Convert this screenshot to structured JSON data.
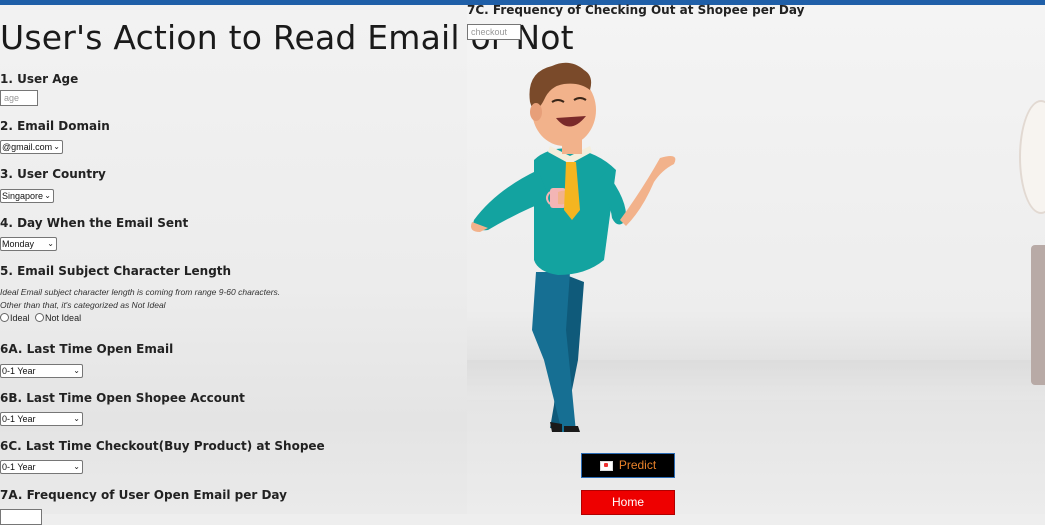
{
  "page": {
    "title": "User's Action to Read Email or Not",
    "accent_color": "#1f5fa8"
  },
  "form": {
    "q1": {
      "label": "1. User Age",
      "placeholder": "age"
    },
    "q2": {
      "label": "2. Email Domain",
      "value": "@gmail.com"
    },
    "q3": {
      "label": "3. User Country",
      "value": "Singapore"
    },
    "q4": {
      "label": "4. Day When the Email Sent",
      "value": "Monday"
    },
    "q5": {
      "label": "5. Email Subject Character Length",
      "note_line1": "Ideal Email subject character length is coming from range 9-60 characters.",
      "note_line2": "Other than that, it's categorized as Not Ideal",
      "option_ideal": "Ideal",
      "option_not_ideal": "Not Ideal"
    },
    "q6a": {
      "label": "6A. Last Time Open Email",
      "value": "0-1 Year"
    },
    "q6b": {
      "label": "6B. Last Time Open Shopee Account",
      "value": "0-1 Year"
    },
    "q6c": {
      "label": "6C. Last Time Checkout(Buy Product) at Shopee",
      "value": "0-1 Year"
    },
    "q7a": {
      "label": "7A. Frequency of User Open Email per Day"
    },
    "q7c": {
      "label": "7C. Frequency of Checking Out at Shopee per Day",
      "placeholder": "checkout"
    }
  },
  "buttons": {
    "predict": "Predict",
    "home": "Home"
  },
  "colors": {
    "predict_bg": "#000000",
    "predict_text": "#e8822a",
    "home_bg": "#ee0000"
  },
  "icons": {
    "predict": "envelope-icon",
    "illustration": "man-holding-cup-illustration"
  }
}
